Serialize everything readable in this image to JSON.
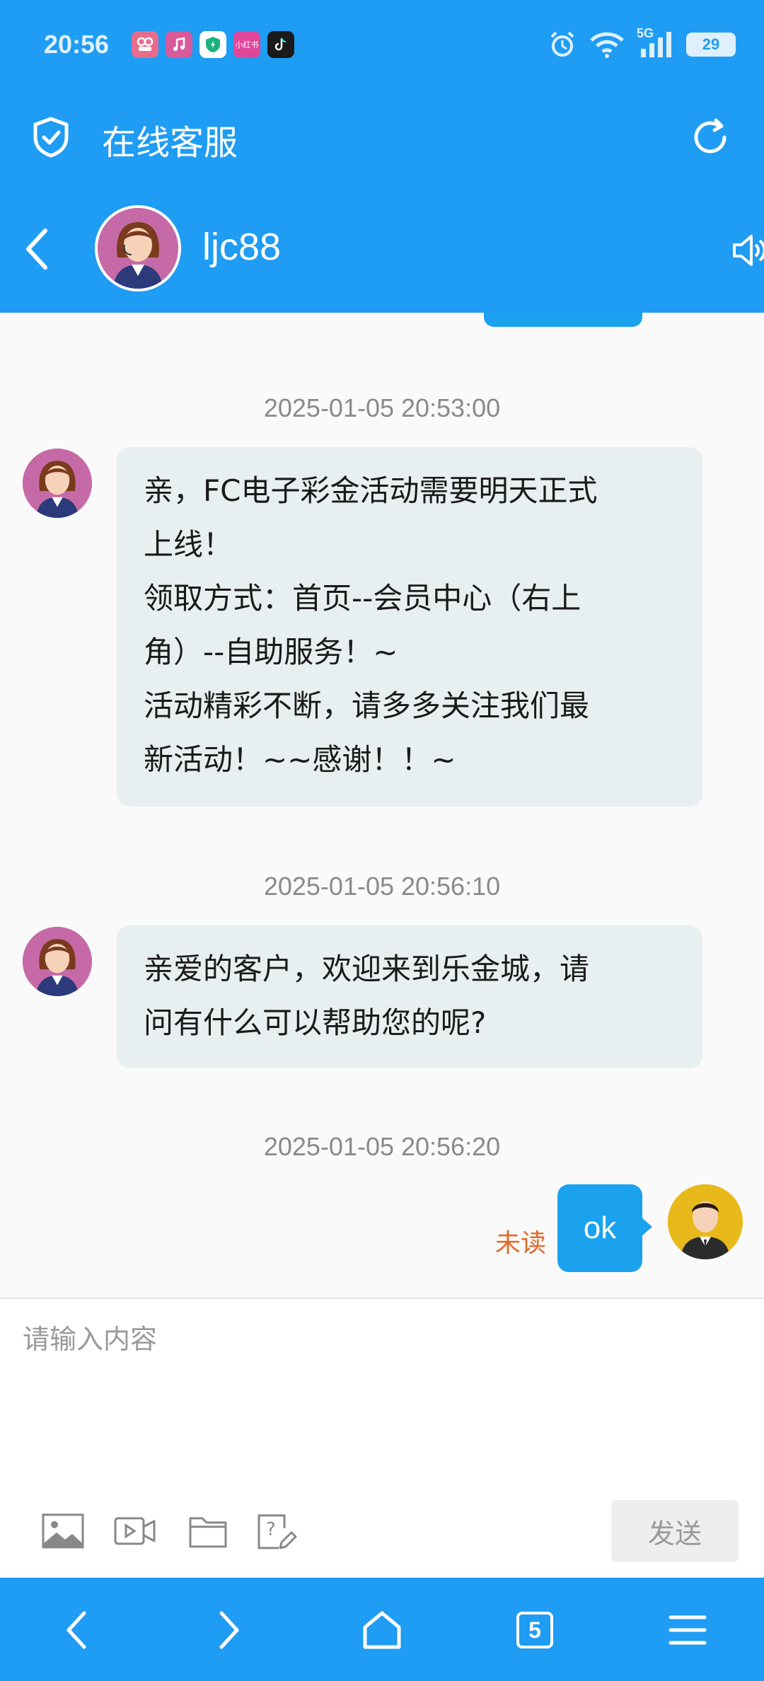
{
  "status_bar": {
    "time": "20:56",
    "network": "5G",
    "battery": "29",
    "app_icons": [
      {
        "name": "video-app-icon",
        "color": "#e86d8d",
        "label": ""
      },
      {
        "name": "music-app-icon",
        "color": "#d85a9a",
        "label": ""
      },
      {
        "name": "security-app-icon",
        "color": "#19b27a",
        "label": ""
      },
      {
        "name": "xiaohongshu-app-icon",
        "color": "#e0479a",
        "label": "小红书"
      },
      {
        "name": "tiktok-app-icon",
        "color": "#1a1a1a",
        "label": ""
      }
    ]
  },
  "header": {
    "title": "在线客服"
  },
  "chat_header": {
    "agent_name": "ljc88"
  },
  "messages": [
    {
      "timestamp": "2025-01-05 20:53:00",
      "direction": "in",
      "text": "亲，FC电子彩金活动需要明天正式\n上线！\n领取方式：首页--会员中心（右上\n角）--自助服务！~\n活动精彩不断，请多多关注我们最\n新活动！~~感谢！！~"
    },
    {
      "timestamp": "2025-01-05 20:56:10",
      "direction": "in",
      "text": "亲爱的客户，欢迎来到乐金城，请\n问有什么可以帮助您的呢?"
    },
    {
      "timestamp": "2025-01-05 20:56:20",
      "direction": "out",
      "text": "ok",
      "status": "未读"
    }
  ],
  "input": {
    "placeholder": "请输入内容",
    "send_label": "发送"
  },
  "bottom_nav": {
    "tabs_count": "5"
  },
  "colors": {
    "primary": "#1f9cf3",
    "bubble_out": "#1aa2ee",
    "bubble_in": "#e8eff0",
    "unread": "#e26a2c"
  }
}
